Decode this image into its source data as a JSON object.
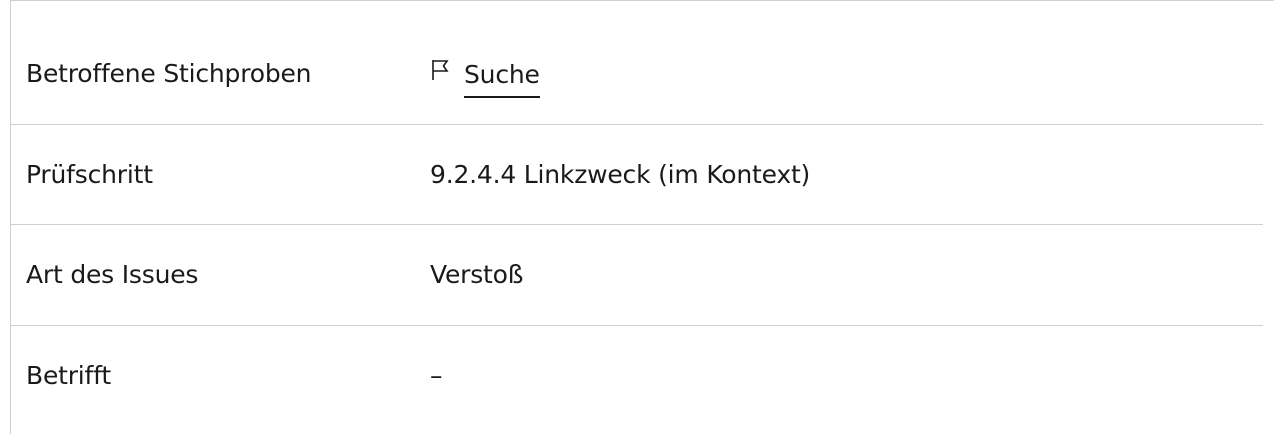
{
  "details": {
    "rows": [
      {
        "label": "Betroffene Stichproben",
        "value": "Suche",
        "icon": "flag-icon"
      },
      {
        "label": "Prüfschritt",
        "value": "9.2.4.4 Linkzweck (im Kontext)"
      },
      {
        "label": "Art des Issues",
        "value": "Verstoß"
      },
      {
        "label": "Betrifft",
        "value": "–"
      }
    ]
  }
}
